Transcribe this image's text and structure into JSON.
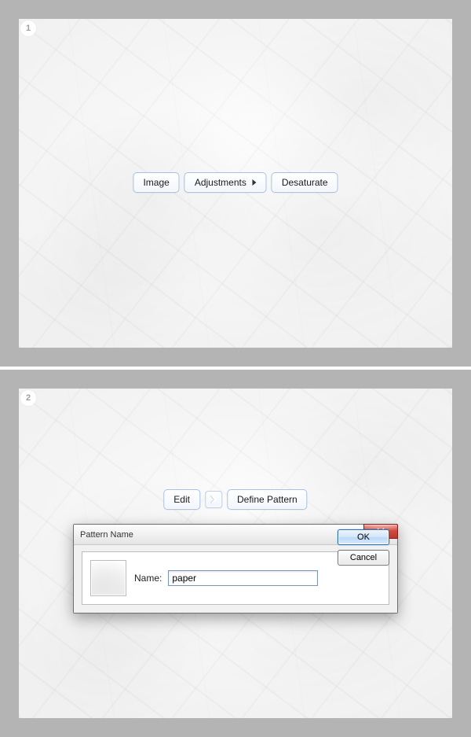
{
  "step1": {
    "badge": "1",
    "menu": {
      "image": "Image",
      "adjustments": "Adjustments",
      "desaturate": "Desaturate"
    }
  },
  "step2": {
    "badge": "2",
    "menu": {
      "edit": "Edit",
      "define_pattern": "Define Pattern"
    },
    "dialog": {
      "title": "Pattern Name",
      "name_label": "Name:",
      "name_value": "paper",
      "ok": "OK",
      "cancel": "Cancel"
    }
  }
}
